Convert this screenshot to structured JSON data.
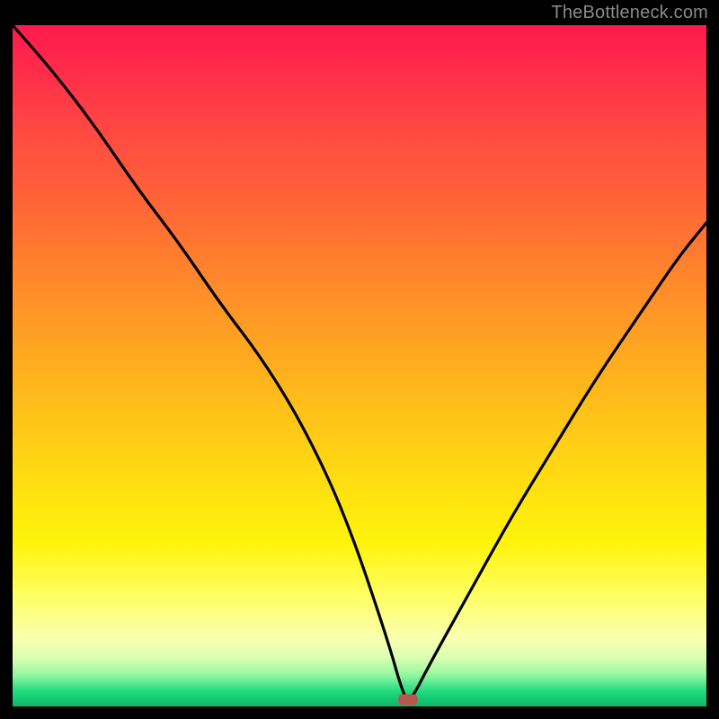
{
  "watermark": "TheBottleneck.com",
  "chart_data": {
    "type": "line",
    "title": "",
    "xlabel": "",
    "ylabel": "",
    "xlim": [
      0,
      100
    ],
    "ylim": [
      0,
      100
    ],
    "grid": false,
    "legend": false,
    "series": [
      {
        "name": "bottleneck-curve",
        "x": [
          0,
          6,
          12,
          18,
          24,
          30,
          36,
          42,
          48,
          54,
          56.5,
          57.5,
          60,
          66,
          72,
          78,
          84,
          90,
          96,
          100
        ],
        "y": [
          100,
          93,
          85,
          76,
          68,
          59,
          51,
          41,
          28,
          10,
          1,
          1,
          6,
          17,
          28,
          38,
          48,
          57,
          66,
          71
        ]
      }
    ],
    "marker": {
      "name": "optimal-point",
      "x": 57,
      "y": 1,
      "color": "#b9564e",
      "shape": "rounded-rect"
    }
  }
}
